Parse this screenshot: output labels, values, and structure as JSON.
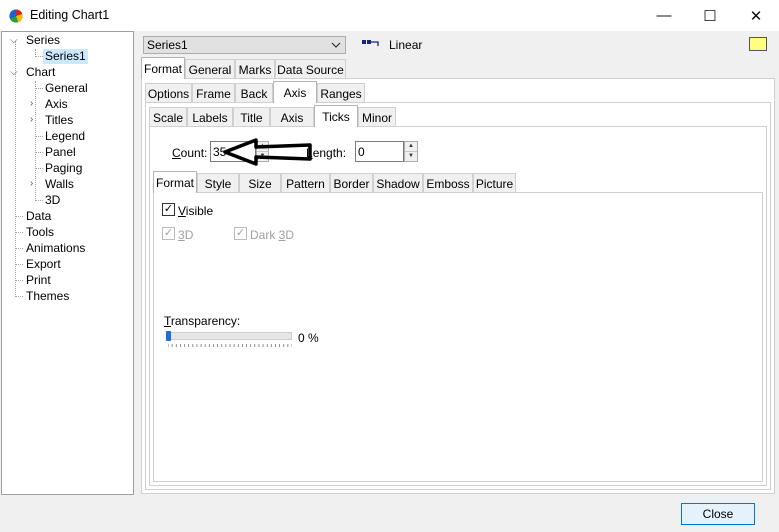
{
  "window": {
    "title": "Editing Chart1",
    "minimize": "—",
    "maximize": "☐",
    "close": "✕"
  },
  "tree": {
    "series": "Series",
    "series1": "Series1",
    "chart": "Chart",
    "general": "General",
    "axis": "Axis",
    "titles": "Titles",
    "legend": "Legend",
    "panel": "Panel",
    "paging": "Paging",
    "walls": "Walls",
    "three_d": "3D",
    "data": "Data",
    "tools": "Tools",
    "animations": "Animations",
    "export": "Export",
    "print": "Print",
    "themes": "Themes"
  },
  "series_selector": {
    "value": "Series1",
    "type_label": "Linear",
    "color": "#ffff80"
  },
  "tabs_main": [
    "Format",
    "General",
    "Marks",
    "Data Source"
  ],
  "tabs_format": [
    "Options",
    "Frame",
    "Back",
    "Axis",
    "Ranges"
  ],
  "tabs_axis": [
    "Scale",
    "Labels",
    "Title",
    "Axis",
    "Ticks",
    "Minor"
  ],
  "ticks": {
    "count_label": "Count:",
    "count_value": "35",
    "length_label": "Length:",
    "length_value": "0"
  },
  "tabs_pen": [
    "Format",
    "Style",
    "Size",
    "Pattern",
    "Border",
    "Shadow",
    "Emboss",
    "Picture"
  ],
  "pen_format": {
    "visible_label": "Visible",
    "visible_checked": true,
    "three_d_label": "3D",
    "dark3d_label": "Dark 3D",
    "transparency_label": "Transparency:",
    "transparency_value": "0 %",
    "transparency": 0
  },
  "buttons": {
    "close_label": "Close"
  },
  "icons": {
    "app": "chart-color-wheel-icon",
    "arrow": "black-arrow-annotation-icon"
  }
}
